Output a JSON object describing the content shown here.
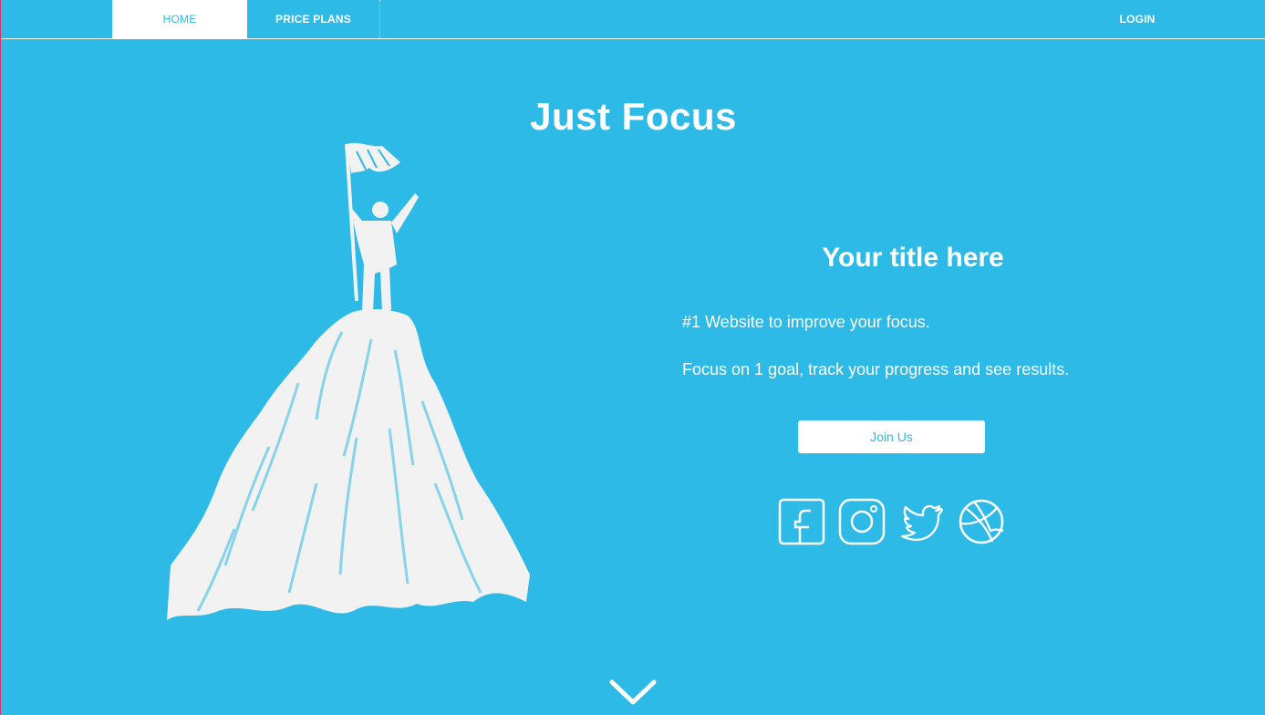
{
  "nav": {
    "home": "HOME",
    "price_plans": "PRICE PLANS",
    "login": "LOGIN"
  },
  "hero": {
    "title": "Just Focus",
    "subtitle": "Your title here",
    "line1": "#1 Website to improve your focus.",
    "line2": "Focus on 1 goal, track your progress and see results.",
    "cta": "Join Us"
  },
  "social": [
    "facebook-icon",
    "instagram-icon",
    "twitter-icon",
    "dribbble-icon"
  ],
  "illustration": "mountain-climber-flag",
  "colors": {
    "background": "#2ebae6",
    "foreground": "#ffffff"
  }
}
